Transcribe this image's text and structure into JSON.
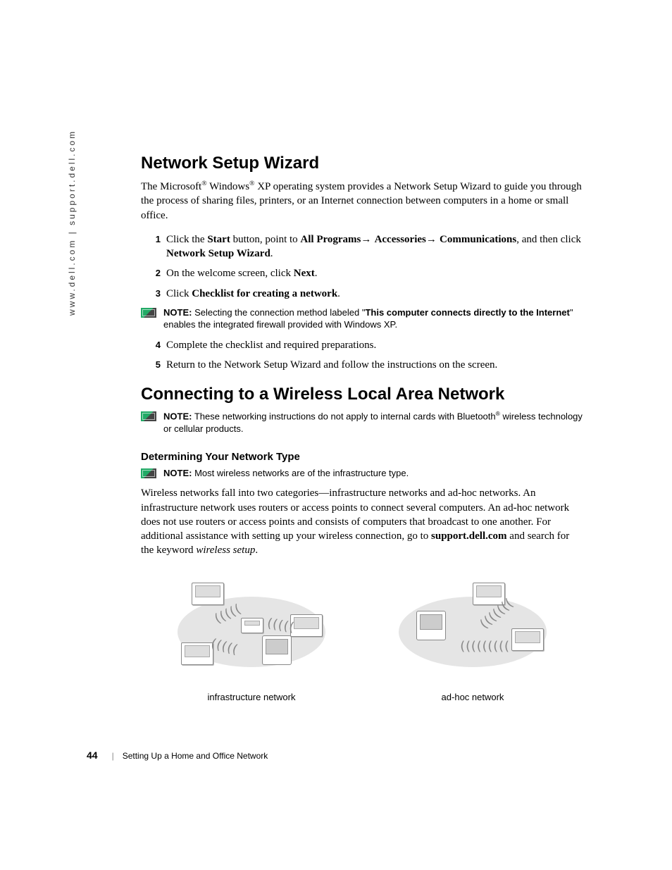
{
  "sidebar_url": "www.dell.com | support.dell.com",
  "section1": {
    "heading": "Network Setup Wizard",
    "intro_parts": {
      "p1": "The Microsoft",
      "p2": " Windows",
      "p3": " XP operating system provides a Network Setup Wizard to guide you through the process of sharing files, printers, or an Internet connection between computers in a home or small office."
    },
    "steps": {
      "s1": {
        "a": "Click the ",
        "start": "Start",
        "b": " button, point to ",
        "allprograms": "All Programs",
        "arrow1": "→ ",
        "accessories": "Accessories",
        "arrow2": "→ ",
        "communications": "Communications",
        "c": ", and then click ",
        "nsw": "Network Setup Wizard",
        "d": "."
      },
      "s2": {
        "a": "On the welcome screen, click ",
        "next": "Next",
        "b": "."
      },
      "s3": {
        "a": "Click ",
        "checklist": "Checklist for creating a network",
        "b": "."
      },
      "s4": {
        "a": "Complete the checklist and required preparations."
      },
      "s5": {
        "a": "Return to the Network Setup Wizard and follow the instructions on the screen."
      }
    },
    "note": {
      "label": "NOTE:",
      "a": " Selecting the connection method labeled \"",
      "quoted": "This computer connects directly to the Internet",
      "b": "\" enables the integrated firewall provided with Windows XP."
    }
  },
  "section2": {
    "heading": "Connecting to a Wireless Local Area Network",
    "note1": {
      "label": "NOTE:",
      "a": " These networking instructions do not apply to internal cards with Bluetooth",
      "b": " wireless technology or cellular products."
    },
    "subhead": "Determining Your Network Type",
    "note2": {
      "label": "NOTE:",
      "a": " Most wireless networks are of the infrastructure type."
    },
    "body": {
      "a": "Wireless networks fall into two categories—infrastructure networks and ad-hoc networks. An infrastructure network uses routers or access points to connect several computers. An ad-hoc network does not use routers or access points and consists of computers that broadcast to one another. For additional assistance with setting up your wireless connection, go to ",
      "link": "support.dell.com",
      "b": " and search for the keyword ",
      "kw": "wireless setup",
      "c": "."
    },
    "diagram_captions": {
      "infra": "infrastructure network",
      "adhoc": "ad-hoc network"
    }
  },
  "footer": {
    "page": "44",
    "title": "Setting Up a Home and Office Network"
  }
}
